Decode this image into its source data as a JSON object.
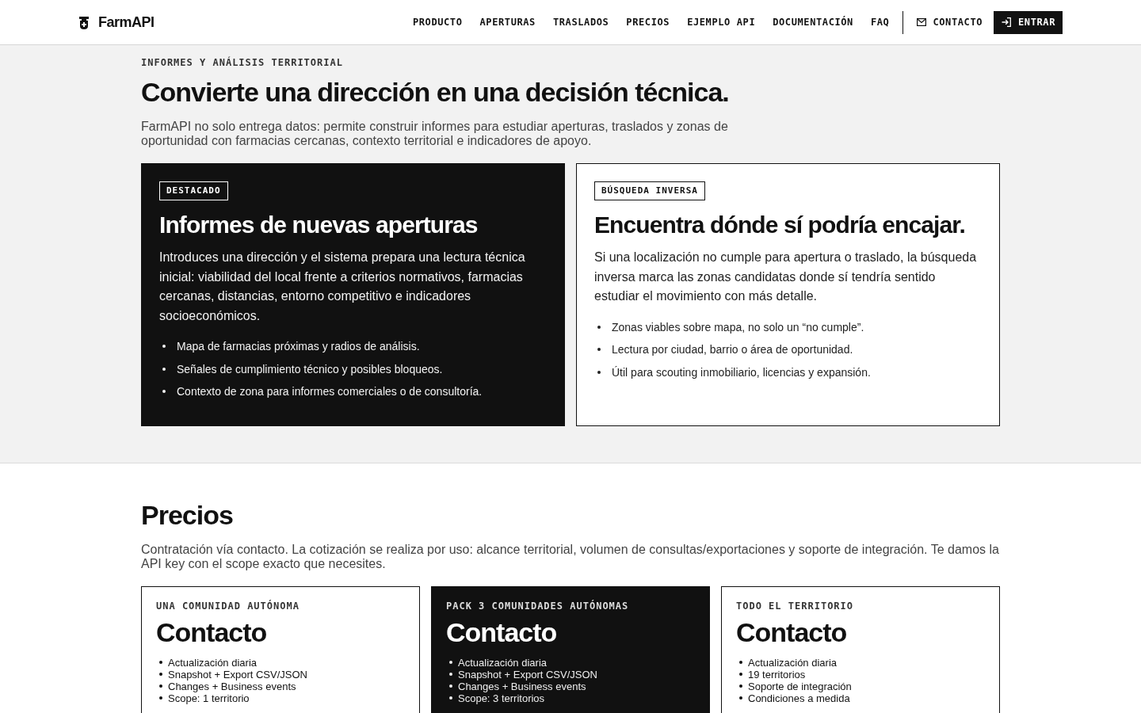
{
  "header": {
    "brand": "FarmAPI",
    "nav": [
      "PRODUCTO",
      "APERTURAS",
      "TRASLADOS",
      "PRECIOS",
      "EJEMPLO API",
      "DOCUMENTACIÓN",
      "FAQ"
    ],
    "contact": "CONTACTO",
    "login": "ENTRAR"
  },
  "reports": {
    "eyebrow": "INFORMES Y ANÁLISIS TERRITORIAL",
    "title": "Convierte una dirección en una decisión técnica.",
    "intro": "FarmAPI no solo entrega datos: permite construir informes para estudiar aperturas, traslados y zonas de oportunidad con farmacias cercanas, contexto territorial e indicadores de apoyo.",
    "cards": [
      {
        "featured": true,
        "badge": "DESTACADO",
        "title": "Informes de nuevas aperturas",
        "text": "Introduces una dirección y el sistema prepara una lectura técnica inicial: viabilidad del local frente a criterios normativos, farmacias cercanas, distancias, entorno competitivo e indicadores socioeconómicos.",
        "bullets": [
          "Mapa de farmacias próximas y radios de análisis.",
          "Señales de cumplimiento técnico y posibles bloqueos.",
          "Contexto de zona para informes comerciales o de consultoría."
        ]
      },
      {
        "featured": false,
        "badge": "BÚSQUEDA INVERSA",
        "title": "Encuentra dónde sí podría encajar.",
        "text": "Si una localización no cumple para apertura o traslado, la búsqueda inversa marca las zonas candidatas donde sí tendría sentido estudiar el movimiento con más detalle.",
        "bullets": [
          "Zonas viables sobre mapa, no solo un “no cumple”.",
          "Lectura por ciudad, barrio o área de oportunidad.",
          "Útil para scouting inmobiliario, licencias y expansión."
        ]
      }
    ]
  },
  "pricing": {
    "title": "Precios",
    "intro": "Contratación vía contacto. La cotización se realiza por uso: alcance territorial, volumen de consultas/exportaciones y soporte de integración. Te damos la API key con el scope exacto que necesites.",
    "plans": [
      {
        "featured": false,
        "scope": "UNA COMUNIDAD AUTÓNOMA",
        "price": "Contacto",
        "features": [
          "Actualización diaria",
          "Snapshot + Export CSV/JSON",
          "Changes + Business events",
          "Scope: 1 territorio"
        ]
      },
      {
        "featured": true,
        "scope": "PACK 3 COMUNIDADES AUTÓNOMAS",
        "price": "Contacto",
        "features": [
          "Actualización diaria",
          "Snapshot + Export CSV/JSON",
          "Changes + Business events",
          "Scope: 3 territorios"
        ]
      },
      {
        "featured": false,
        "scope": "TODO EL TERRITORIO",
        "price": "Contacto",
        "features": [
          "Actualización diaria",
          "19 territorios",
          "Soporte de integración",
          "Condiciones a medida"
        ]
      }
    ]
  }
}
